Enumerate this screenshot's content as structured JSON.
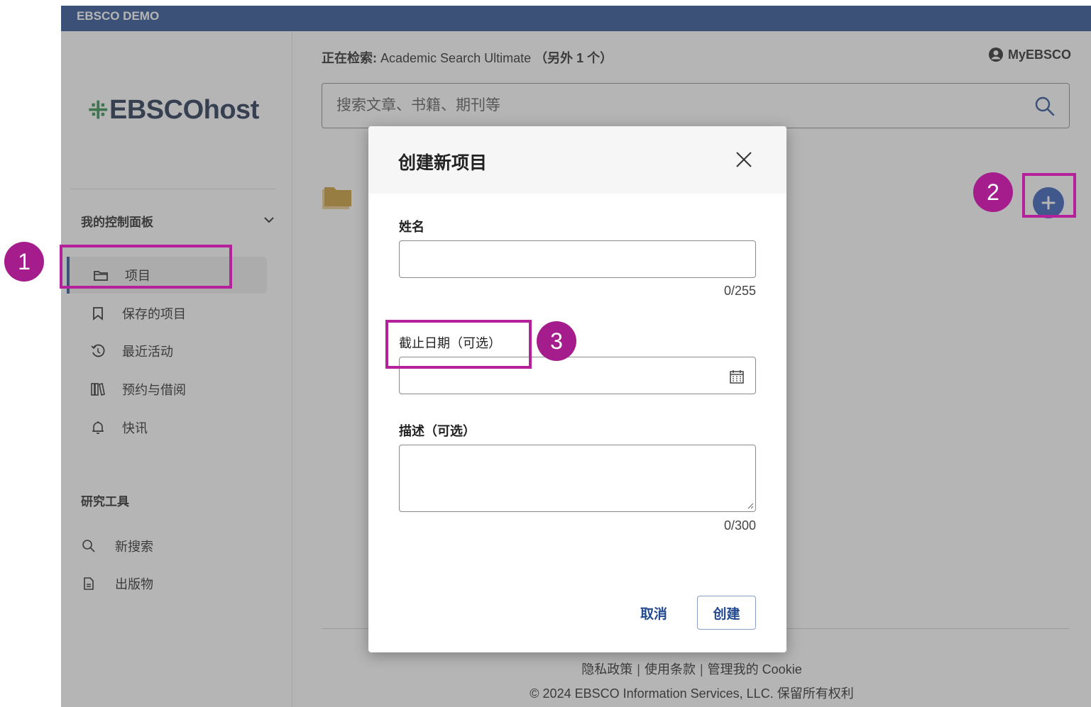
{
  "topbar": {
    "title": "EBSCO DEMO"
  },
  "logo": {
    "text": "EBSCOhost"
  },
  "sidebar": {
    "dashboard_title": "我的控制面板",
    "items": [
      {
        "label": "项目",
        "icon": "folder-outline-icon",
        "active": true
      },
      {
        "label": "保存的项目",
        "icon": "bookmark-icon"
      },
      {
        "label": "最近活动",
        "icon": "history-icon"
      },
      {
        "label": "预约与借阅",
        "icon": "books-icon"
      },
      {
        "label": "快讯",
        "icon": "bell-icon"
      }
    ],
    "tools_title": "研究工具",
    "tools": [
      {
        "label": "新搜索",
        "icon": "search-icon"
      },
      {
        "label": "出版物",
        "icon": "document-icon"
      }
    ]
  },
  "header": {
    "searching_label": "正在检索:",
    "searching_db": "Academic Search Ultimate",
    "searching_extra": "（另外 1 个）",
    "account_label": "MyEBSCO"
  },
  "search": {
    "placeholder": "搜索文章、书籍、期刊等"
  },
  "footer": {
    "links": [
      "隐私政策",
      "使用条款",
      "管理我的 Cookie"
    ],
    "copyright": "© 2024 EBSCO Information Services, LLC. 保留所有权利"
  },
  "modal": {
    "title": "创建新项目",
    "name_label": "姓名",
    "name_value": "",
    "name_counter": "0/255",
    "date_label": "截止日期（可选）",
    "date_value": "",
    "desc_label": "描述（可选）",
    "desc_value": "",
    "desc_counter": "0/300",
    "cancel_label": "取消",
    "create_label": "创建"
  },
  "callouts": [
    "1",
    "2",
    "3"
  ],
  "colors": {
    "brand_blue": "#244a8e",
    "accent_blue": "#2c57b5",
    "annotation_magenta": "#b5219a",
    "folder_gold": "#c99a2e"
  }
}
